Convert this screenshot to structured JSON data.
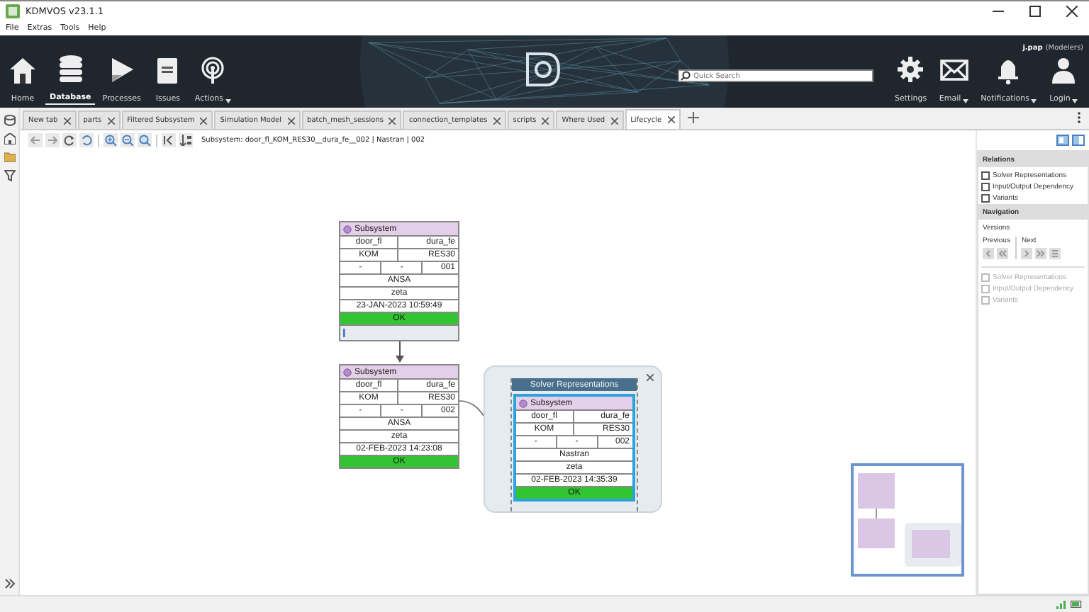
{
  "window": {
    "title": "KDMVOS v23.1.1"
  },
  "menu": [
    "File",
    "Extras",
    "Tools",
    "Help"
  ],
  "ribbon": {
    "items": [
      {
        "label": "Home",
        "selected": false,
        "dropdown": false
      },
      {
        "label": "Database",
        "selected": true,
        "dropdown": false
      },
      {
        "label": "Processes",
        "selected": false,
        "dropdown": false
      },
      {
        "label": "Issues",
        "selected": false,
        "dropdown": false
      },
      {
        "label": "Actions",
        "selected": false,
        "dropdown": true
      }
    ],
    "search": {
      "placeholder": "Quick Search"
    },
    "user": "j.pap",
    "role": "(Modelers)",
    "right_items": [
      {
        "label": "Settings",
        "dropdown": false
      },
      {
        "label": "Email",
        "dropdown": true
      },
      {
        "label": "Notifications",
        "dropdown": true
      },
      {
        "label": "Login",
        "dropdown": true
      }
    ]
  },
  "tabs": [
    {
      "label": "New tab",
      "selected": false
    },
    {
      "label": "parts",
      "selected": false
    },
    {
      "label": "Filtered Subsystem",
      "selected": false
    },
    {
      "label": "Simulation Model",
      "selected": false
    },
    {
      "label": "batch_mesh_sessions",
      "selected": false
    },
    {
      "label": "connection_templates",
      "selected": false
    },
    {
      "label": "scripts",
      "selected": false
    },
    {
      "label": "Where Used",
      "selected": false
    },
    {
      "label": "Lifecycle",
      "selected": true
    }
  ],
  "breadcrumb": "Subsystem: door_fl_KOM_RES30__dura_fe__002 | Nastran | 002",
  "nodes": [
    {
      "title": "Subsystem",
      "selected": false,
      "expander": true,
      "fields": [
        "door_fl",
        "dura_fe",
        "KOM",
        "RES30",
        "-",
        "-",
        "001",
        "ANSA",
        "zeta",
        "23-JAN-2023 10:59:49"
      ],
      "status": "OK"
    },
    {
      "title": "Subsystem",
      "selected": false,
      "expander": false,
      "fields": [
        "door_fl",
        "dura_fe",
        "KOM",
        "RES30",
        "-",
        "-",
        "002",
        "ANSA",
        "zeta",
        "02-FEB-2023 14:23:08"
      ],
      "status": "OK"
    }
  ],
  "group": {
    "title": "Solver Representations",
    "nodes": [
      {
        "title": "Subsystem",
        "selected": true,
        "expander": false,
        "fields": [
          "door_fl",
          "dura_fe",
          "KOM",
          "RES30",
          "-",
          "-",
          "002",
          "Nastran",
          "zeta",
          "02-FEB-2023 14:35:39"
        ],
        "status": "OK"
      }
    ]
  },
  "panel": {
    "relations": {
      "title": "Relations",
      "options": [
        {
          "label": "Solver Representations",
          "checked": false
        },
        {
          "label": "Input/Output Dependency",
          "checked": false
        },
        {
          "label": "Variants",
          "checked": false
        }
      ]
    },
    "navigation": {
      "title": "Navigation",
      "subtitle": "Versions",
      "previous": "Previous",
      "next": "Next",
      "options": [
        {
          "label": "Solver Representations",
          "checked": false,
          "disabled": true
        },
        {
          "label": "Input/Output Dependency",
          "checked": false,
          "disabled": true
        },
        {
          "label": "Variants",
          "checked": false,
          "disabled": true
        }
      ]
    }
  }
}
